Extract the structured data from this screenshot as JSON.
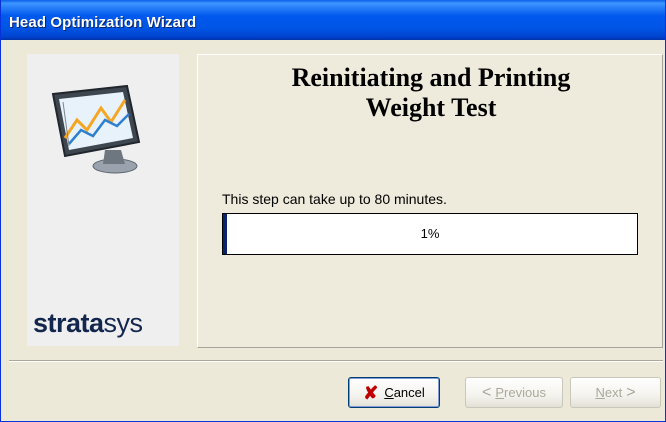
{
  "window": {
    "title": "Head Optimization Wizard"
  },
  "sidebar": {
    "logo_bold": "strata",
    "logo_light": "sys"
  },
  "main": {
    "heading_line1": "Reinitiating and Printing",
    "heading_line2": "Weight Test",
    "step_text": "This step can take up to 80 minutes.",
    "progress_percent": 1,
    "progress_label": "1%"
  },
  "buttons": {
    "cancel_first": "C",
    "cancel_rest": "ancel",
    "previous_first": "P",
    "previous_rest": "revious",
    "next_first": "N",
    "next_rest": "ext"
  },
  "icons": {
    "monitor": "monitor-chart-icon",
    "cancel": "x-icon",
    "previous": "arrow-left-icon",
    "next": "arrow-right-icon"
  },
  "colors": {
    "titlebar": "#0058EE",
    "progress_fill": "#0A246A",
    "cancel_icon": "#C00000",
    "logo": "#12264E"
  }
}
